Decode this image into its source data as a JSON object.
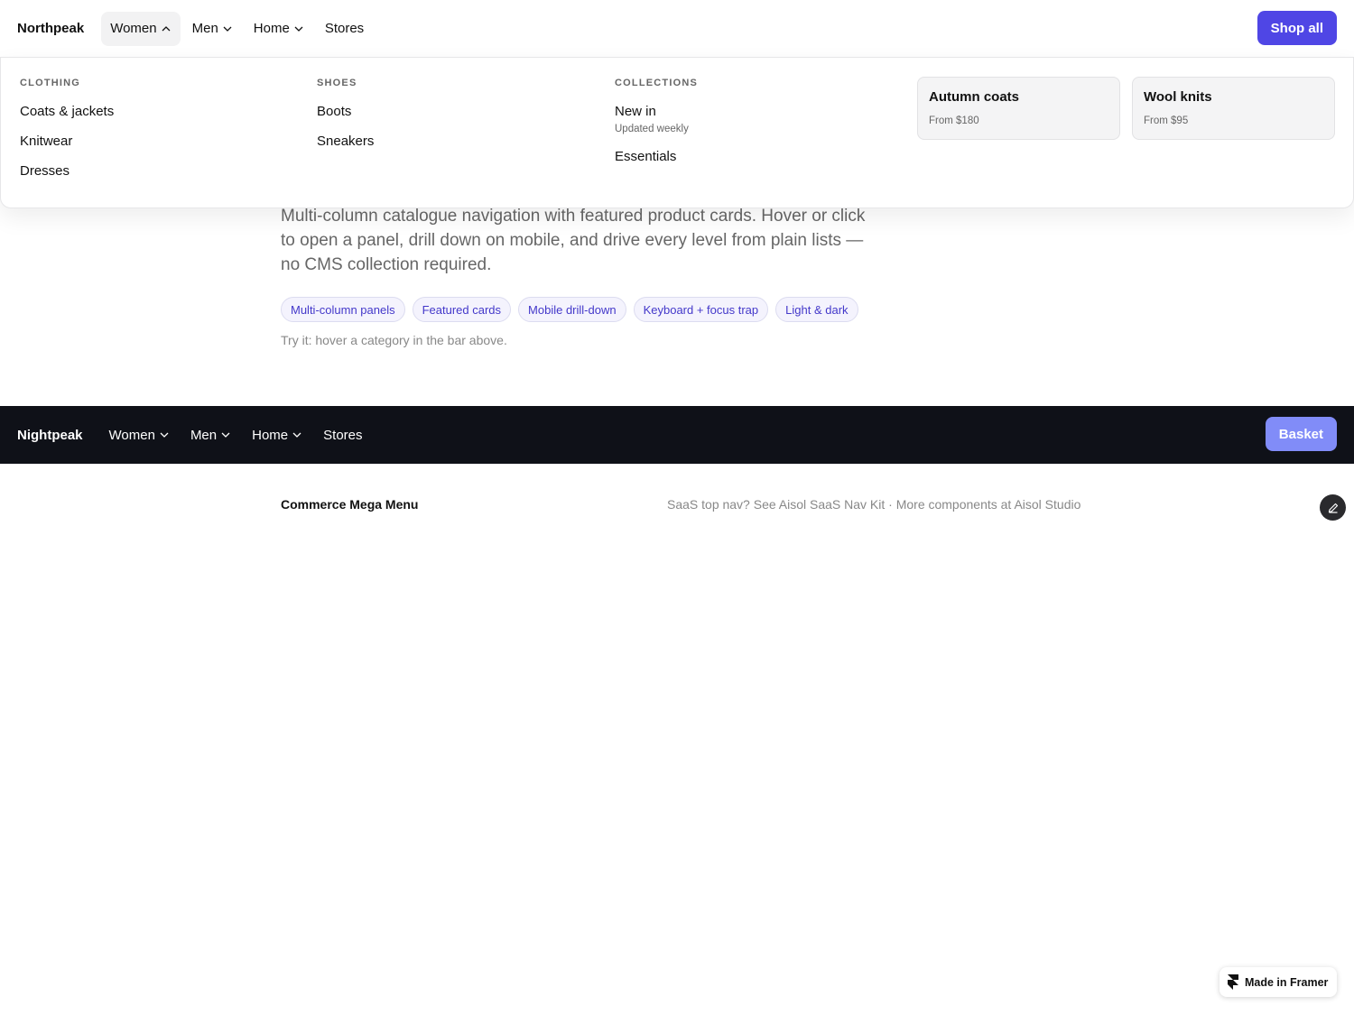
{
  "light_nav": {
    "brand": "Northpeak",
    "items": [
      {
        "label": "Women",
        "has_dropdown": true,
        "open": true
      },
      {
        "label": "Men",
        "has_dropdown": true
      },
      {
        "label": "Home",
        "has_dropdown": true
      },
      {
        "label": "Stores",
        "has_dropdown": false
      }
    ],
    "cta": "Shop all"
  },
  "mega_panel": {
    "columns": [
      {
        "title": "Clothing",
        "links": [
          "Coats & jackets",
          "Knitwear",
          "Dresses"
        ]
      },
      {
        "title": "Shoes",
        "links": [
          "Boots",
          "Sneakers"
        ]
      },
      {
        "title": "Collections",
        "links": [
          {
            "label": "New in",
            "sub": "Updated weekly"
          },
          {
            "label": "Essentials"
          }
        ]
      }
    ],
    "cards": [
      {
        "title": "Autumn coats",
        "price": "From $180"
      },
      {
        "title": "Wool knits",
        "price": "From $95"
      }
    ]
  },
  "content": {
    "description": "Multi-column catalogue navigation with featured product cards. Hover or click to open a panel, drill down on mobile, and drive every level from plain lists — no CMS collection required.",
    "pills": [
      "Multi-column panels",
      "Featured cards",
      "Mobile drill-down",
      "Keyboard + focus trap",
      "Light & dark"
    ],
    "hint": "Try it: hover a category in the bar above."
  },
  "dark_nav": {
    "brand": "Nightpeak",
    "items": [
      {
        "label": "Women",
        "has_dropdown": true
      },
      {
        "label": "Men",
        "has_dropdown": true
      },
      {
        "label": "Home",
        "has_dropdown": true
      },
      {
        "label": "Stores",
        "has_dropdown": false
      }
    ],
    "cta": "Basket"
  },
  "footer": {
    "title": "Commerce Mega Menu",
    "text": "SaaS top nav? See Aisol SaaS Nav Kit · More components at Aisol Studio",
    "badge": "Made in Framer"
  },
  "colors": {
    "accent": "#4f46e5",
    "accent_light": "#818cf8",
    "dark_bg": "#0f1118"
  },
  "icons": {
    "chevron_down": "chevron-down-icon",
    "chevron_up": "chevron-up-icon",
    "edit": "pencil-icon",
    "framer": "framer-logo-icon"
  }
}
